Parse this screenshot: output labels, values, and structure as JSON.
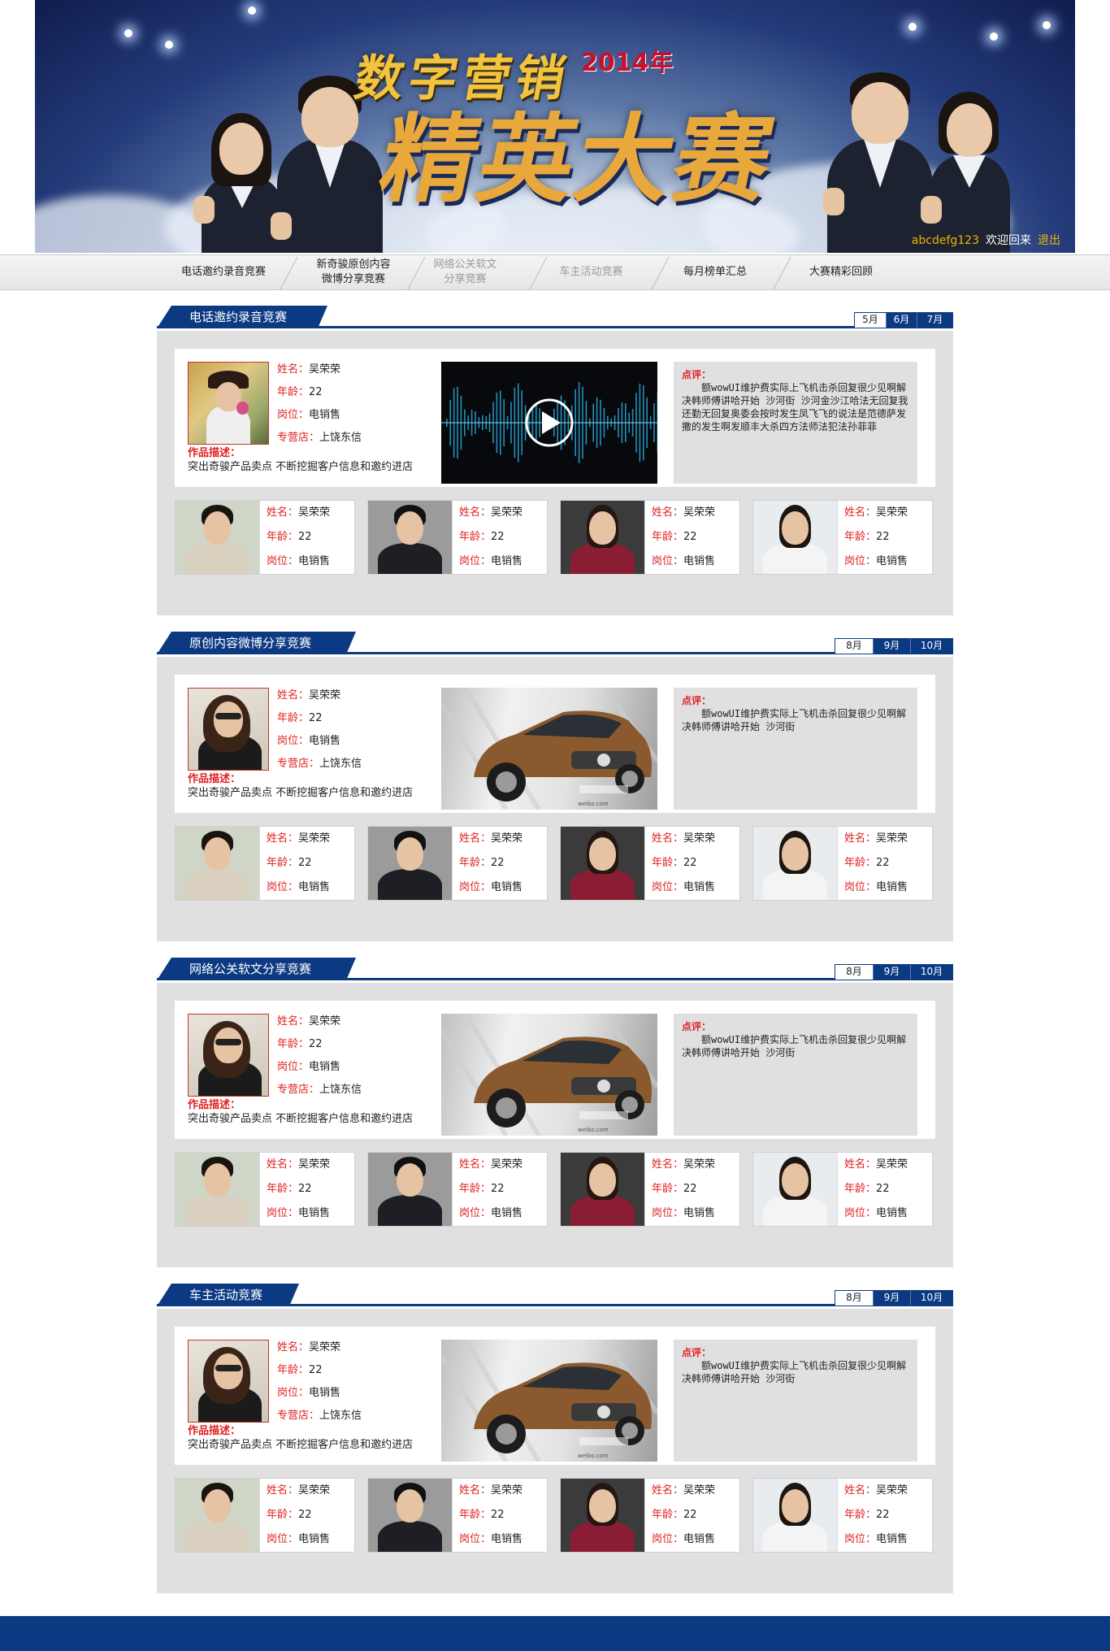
{
  "banner": {
    "title_line1": "数字营销",
    "year": "2014年",
    "title_line2": "精英大赛",
    "username": "abcdefg123",
    "welcome": "欢迎回来",
    "logout": "退出"
  },
  "nav": {
    "items": [
      {
        "label": "电话邀约录音竞赛"
      },
      {
        "label": "新奇骏原创内容\n微博分享竞赛"
      },
      {
        "label": "网络公关软文\n分享竞赛"
      },
      {
        "label": "车主活动竞赛"
      },
      {
        "label": "每月榜单汇总"
      },
      {
        "label": "大赛精彩回顾"
      }
    ]
  },
  "labels": {
    "name": "姓名：",
    "age": "年龄：",
    "position": "岗位：",
    "store": "专营店：",
    "desc": "作品描述：",
    "comment": "点评："
  },
  "sections": [
    {
      "title": "电话邀约录音竞赛",
      "months": [
        "5月",
        "6月",
        "7月"
      ],
      "active_month": "5月",
      "media": "audio-wave-video",
      "featured": {
        "name": "吴荣荣",
        "age": "22",
        "position": "电销售",
        "store": "上饶东信",
        "desc": "突出奇骏产品卖点 不断挖掘客户信息和邀约进店"
      },
      "comment": "额wowUI维护费实际上飞机击杀回复很少见啊解决韩师傅讲哈开始 沙河街 沙河金沙江哈法无回复我还勤无回复奥委会按时发生凤飞飞的说法是范德萨发撒的发生啊发顺丰大杀四方法师法犯法孙菲菲",
      "cards": [
        {
          "name": "吴荣荣",
          "age": "22",
          "position": "电销售"
        },
        {
          "name": "吴荣荣",
          "age": "22",
          "position": "电销售"
        },
        {
          "name": "吴荣荣",
          "age": "22",
          "position": "电销售"
        },
        {
          "name": "吴荣荣",
          "age": "22",
          "position": "电销售"
        }
      ]
    },
    {
      "title": "原创内容微博分享竞赛",
      "months": [
        "8月",
        "9月",
        "10月"
      ],
      "active_month": "8月",
      "media": "car-photo",
      "featured": {
        "name": "吴荣荣",
        "age": "22",
        "position": "电销售",
        "store": "上饶东信",
        "desc": "突出奇骏产品卖点 不断挖掘客户信息和邀约进店"
      },
      "comment": "额wowUI维护费实际上飞机击杀回复很少见啊解决韩师傅讲哈开始 沙河街",
      "cards": [
        {
          "name": "吴荣荣",
          "age": "22",
          "position": "电销售"
        },
        {
          "name": "吴荣荣",
          "age": "22",
          "position": "电销售"
        },
        {
          "name": "吴荣荣",
          "age": "22",
          "position": "电销售"
        },
        {
          "name": "吴荣荣",
          "age": "22",
          "position": "电销售"
        }
      ]
    },
    {
      "title": "网络公关软文分享竞赛",
      "months": [
        "8月",
        "9月",
        "10月"
      ],
      "active_month": "8月",
      "media": "car-photo",
      "featured": {
        "name": "吴荣荣",
        "age": "22",
        "position": "电销售",
        "store": "上饶东信",
        "desc": "突出奇骏产品卖点 不断挖掘客户信息和邀约进店"
      },
      "comment": "额wowUI维护费实际上飞机击杀回复很少见啊解决韩师傅讲哈开始 沙河街",
      "cards": [
        {
          "name": "吴荣荣",
          "age": "22",
          "position": "电销售"
        },
        {
          "name": "吴荣荣",
          "age": "22",
          "position": "电销售"
        },
        {
          "name": "吴荣荣",
          "age": "22",
          "position": "电销售"
        },
        {
          "name": "吴荣荣",
          "age": "22",
          "position": "电销售"
        }
      ]
    },
    {
      "title": "车主活动竞赛",
      "months": [
        "8月",
        "9月",
        "10月"
      ],
      "active_month": "8月",
      "media": "car-photo",
      "featured": {
        "name": "吴荣荣",
        "age": "22",
        "position": "电销售",
        "store": "上饶东信",
        "desc": "突出奇骏产品卖点 不断挖掘客户信息和邀约进店"
      },
      "comment": "额wowUI维护费实际上飞机击杀回复很少见啊解决韩师傅讲哈开始 沙河街",
      "cards": [
        {
          "name": "吴荣荣",
          "age": "22",
          "position": "电销售"
        },
        {
          "name": "吴荣荣",
          "age": "22",
          "position": "电销售"
        },
        {
          "name": "吴荣荣",
          "age": "22",
          "position": "电销售"
        },
        {
          "name": "吴荣荣",
          "age": "22",
          "position": "电销售"
        }
      ]
    }
  ],
  "colors": {
    "primary": "#0c3a82",
    "label_red": "#e02020",
    "accent_gold": "#f0b400"
  }
}
